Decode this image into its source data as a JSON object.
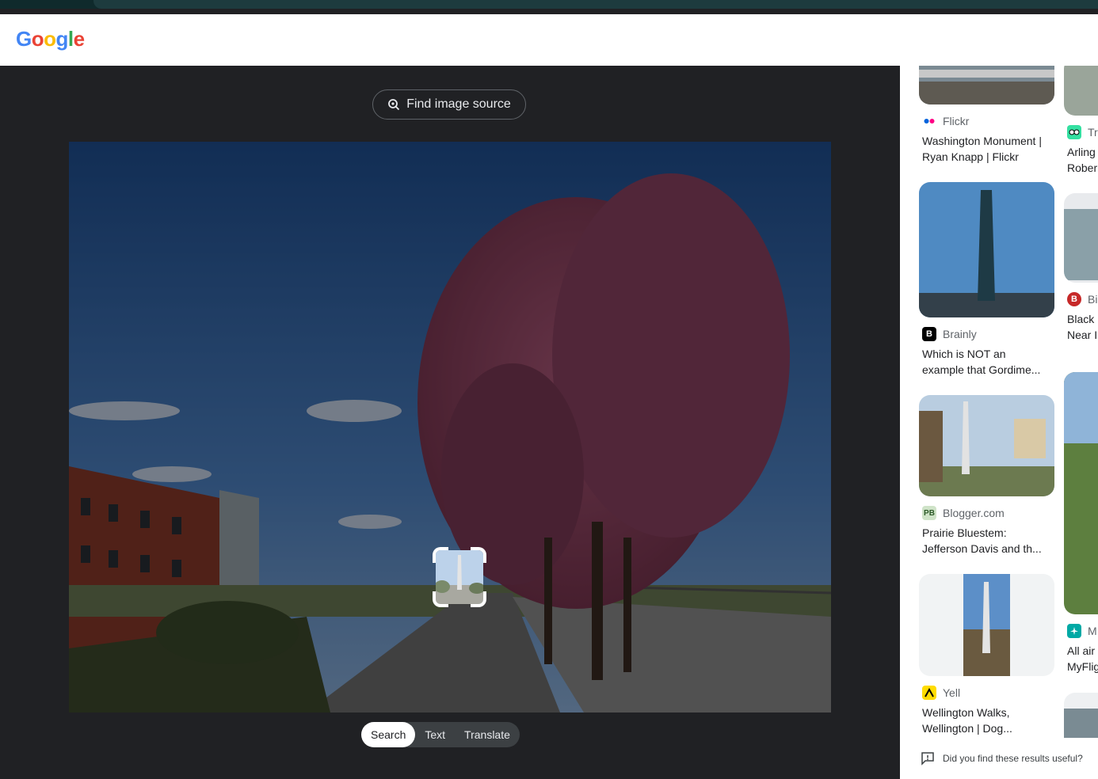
{
  "header": {
    "logo": {
      "g1": "G",
      "o1": "o",
      "o2": "o",
      "g2": "g",
      "l": "l",
      "e": "e"
    }
  },
  "lens": {
    "find_source_label": "Find image source",
    "modes": [
      "Search",
      "Text",
      "Translate"
    ],
    "active_mode": "Search"
  },
  "results": [
    {
      "source": "Flickr",
      "title_line1": "Washington Monument |",
      "title_line2": "Ryan Knapp | Flickr"
    },
    {
      "source": "Brainly",
      "title_line1": "Which is NOT an",
      "title_line2": "example that Gordime..."
    },
    {
      "source": "Blogger.com",
      "title_line1": "Prairie Bluestem:",
      "title_line2": "Jefferson Davis and th..."
    },
    {
      "source": "Yell",
      "title_line1": "Wellington Walks,",
      "title_line2": "Wellington | Dog..."
    }
  ],
  "results_col2": [
    {
      "source": "Tr",
      "title_line1": "Arling",
      "title_line2": "Rober"
    },
    {
      "source": "Bi",
      "title_line1": "Black",
      "title_line2": "Near I"
    },
    {
      "source": "M",
      "title_line1": "All air",
      "title_line2": "MyFlig"
    }
  ],
  "feedback": {
    "label": "Did you find these results useful?"
  },
  "colors": {
    "accent": "#4285f4",
    "dark_bg": "#202124",
    "chip_bg": "#3c4043"
  }
}
